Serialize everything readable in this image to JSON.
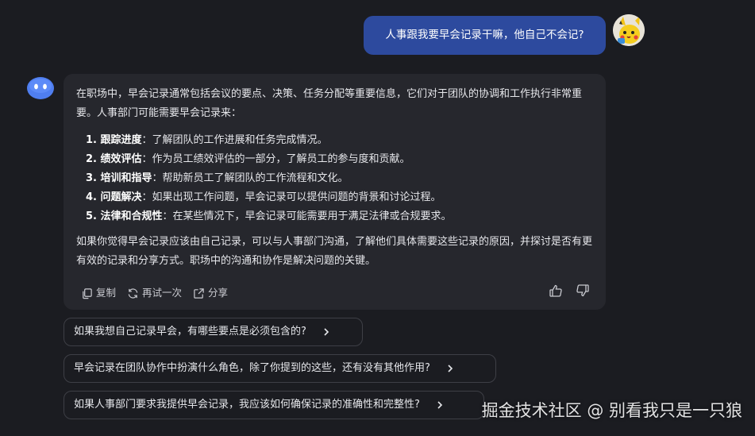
{
  "user_message": {
    "text": "人事跟我要早会记录干嘛，他自己不会记?",
    "avatar_icon": "pikachu-avatar-icon"
  },
  "bot_message": {
    "avatar_icon": "bot-avatar-icon",
    "intro": "在职场中，早会记录通常包括会议的要点、决策、任务分配等重要信息，它们对于团队的协调和工作执行非常重要。人事部门可能需要早会记录来：",
    "points": [
      {
        "num": "1.",
        "title": "跟踪进度",
        "text": "：了解团队的工作进展和任务完成情况。"
      },
      {
        "num": "2.",
        "title": "绩效评估",
        "text": "：作为员工绩效评估的一部分，了解员工的参与度和贡献。"
      },
      {
        "num": "3.",
        "title": "培训和指导",
        "text": "：帮助新员工了解团队的工作流程和文化。"
      },
      {
        "num": "4.",
        "title": "问题解决",
        "text": "：如果出现工作问题，早会记录可以提供问题的背景和讨论过程。"
      },
      {
        "num": "5.",
        "title": "法律和合规性",
        "text": "：在某些情况下，早会记录可能需要用于满足法律或合规要求。"
      }
    ],
    "closing": "如果你觉得早会记录应该由自己记录，可以与人事部门沟通，了解他们具体需要这些记录的原因，并探讨是否有更有效的记录和分享方式。职场中的沟通和协作是解决问题的关键。",
    "actions": {
      "copy": "复制",
      "retry": "再试一次",
      "share": "分享"
    }
  },
  "suggestions": [
    "如果我想自己记录早会，有哪些要点是必须包含的?",
    "早会记录在团队协作中扮演什么角色，除了你提到的这些，还有没有其他作用?",
    "如果人事部门要求我提供早会记录，我应该如何确保记录的准确性和完整性?"
  ],
  "watermark": "掘金技术社区 @ 别看我只是一只狼",
  "colors": {
    "background": "#1b1c21",
    "user_bubble": "#2d4a9e",
    "bot_bubble": "#26272d",
    "suggestion_border": "#3e3f46"
  }
}
